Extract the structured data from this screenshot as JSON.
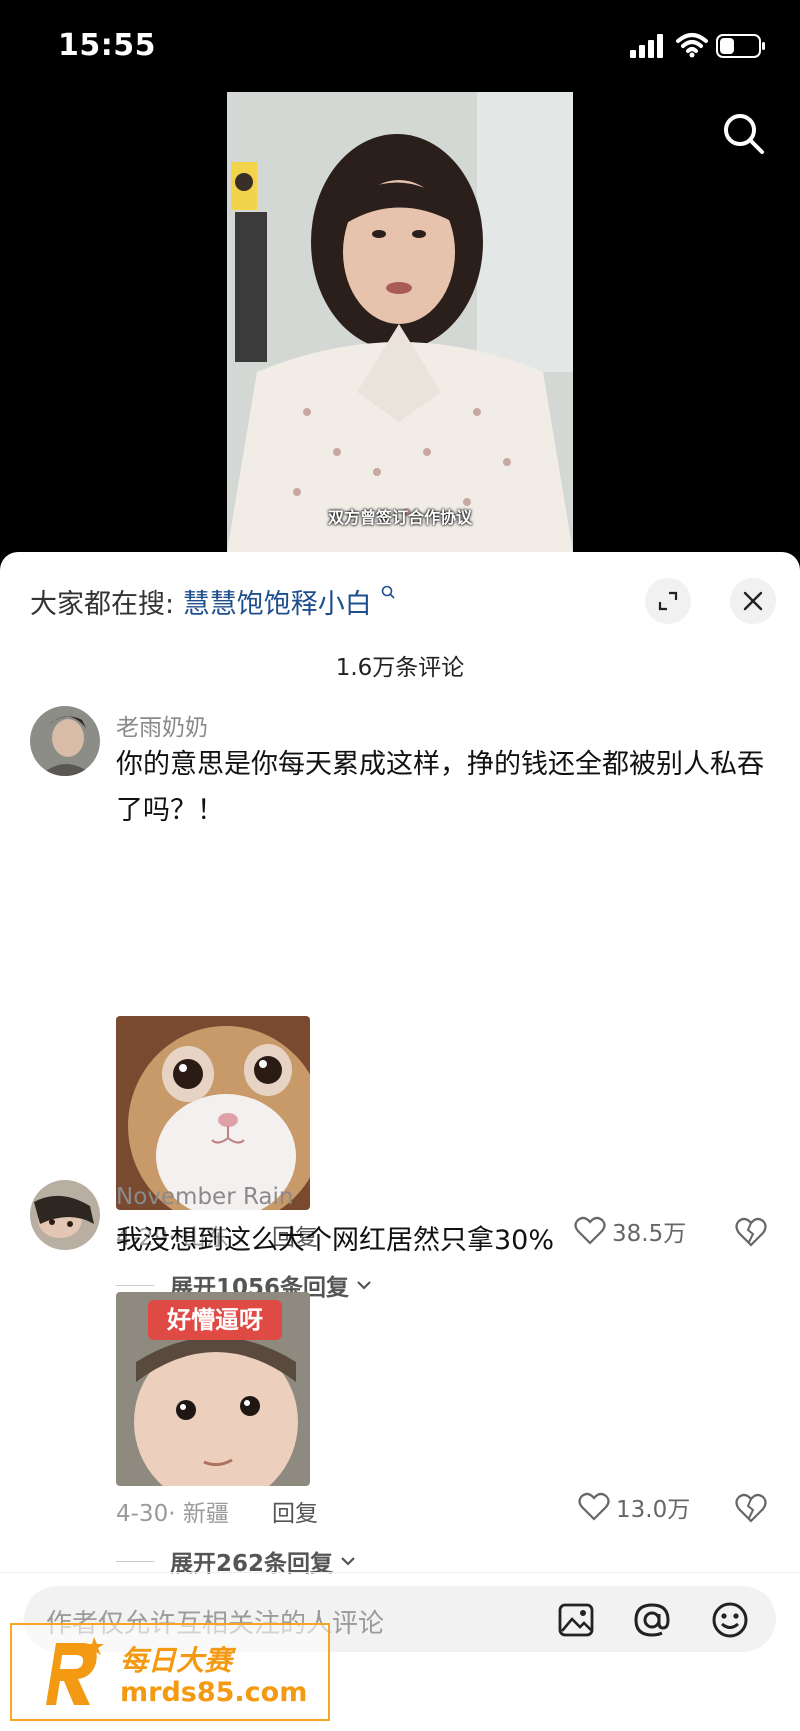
{
  "status_bar": {
    "time": "15:55"
  },
  "video": {
    "subtitle": "双方曾签订合作协议"
  },
  "sheet": {
    "search_prefix": "大家都在搜:",
    "search_term": "慧慧饱饱释小白",
    "comment_count": "1.6万条评论"
  },
  "comments": [
    {
      "username": "老雨奶奶",
      "text": "你的意思是你每天累成这样，挣的钱还全都被别人私吞了吗？！",
      "meta": "4-29· 山东",
      "reply_label": "回复",
      "likes": "38.5万",
      "expand": "展开1056条回复"
    },
    {
      "username": "November Rain",
      "text": "我没想到这么大个网红居然只拿30%",
      "sticker_caption": "好懵逼呀",
      "meta": "4-30· 新疆",
      "reply_label": "回复",
      "likes": "13.0万",
      "expand": "展开262条回复"
    }
  ],
  "input": {
    "placeholder": "作者仅允许互相关注的人评论"
  },
  "watermark": {
    "line1": "每日大赛",
    "line2": "mrds85.com"
  },
  "colors": {
    "accent_link": "#1f4e8c",
    "watermark": "#f39a12"
  }
}
